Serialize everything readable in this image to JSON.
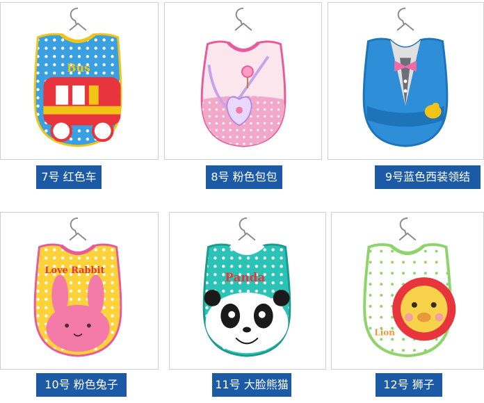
{
  "products": [
    {
      "label": "7号 红色车",
      "bib_text": "Bus"
    },
    {
      "label": "8号 粉色包包"
    },
    {
      "label": "9号蓝色西装领结"
    },
    {
      "label": "10号 粉色兔子",
      "bib_text": "Love Rabbit"
    },
    {
      "label": "11号 大脸熊猫",
      "bib_text": "Panda"
    },
    {
      "label": "12号 狮子",
      "bib_text": "Lion"
    }
  ]
}
